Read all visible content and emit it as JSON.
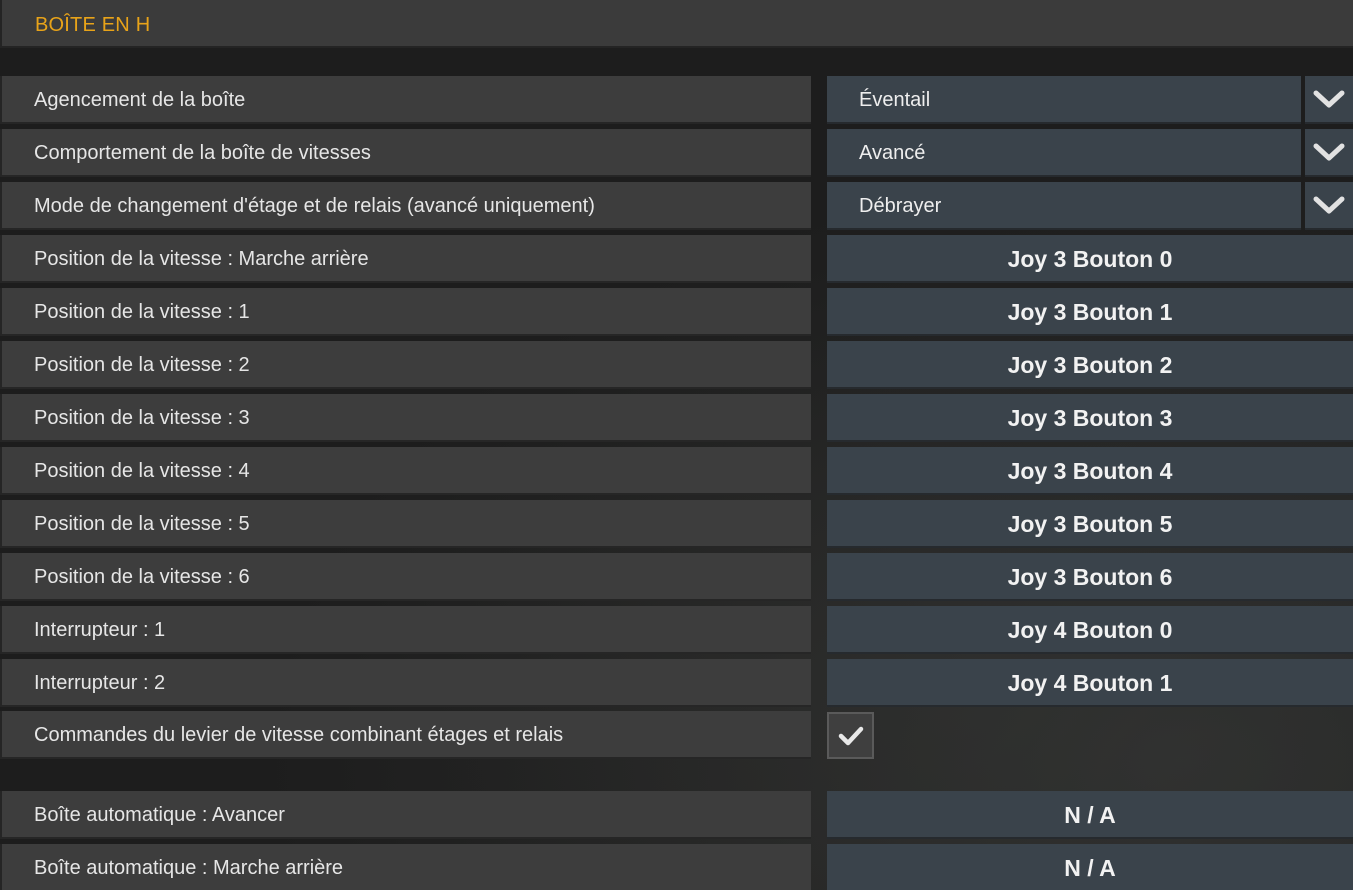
{
  "section": {
    "title": "BOÎTE EN H",
    "title_color": "#e8a319"
  },
  "settings": [
    {
      "label": "Agencement de la boîte",
      "type": "dropdown",
      "value": "Éventail",
      "icon": "chevron-down-icon"
    },
    {
      "label": "Comportement de la boîte de vitesses",
      "type": "dropdown",
      "value": "Avancé",
      "icon": "chevron-down-icon"
    },
    {
      "label": "Mode de changement d'étage et de relais (avancé uniquement)",
      "type": "dropdown",
      "value": "Débrayer",
      "icon": "chevron-down-icon"
    },
    {
      "label": "Position de la vitesse : Marche arrière",
      "type": "binding",
      "value": "Joy 3 Bouton 0"
    },
    {
      "label": "Position de la vitesse : 1",
      "type": "binding",
      "value": "Joy 3 Bouton 1"
    },
    {
      "label": "Position de la vitesse : 2",
      "type": "binding",
      "value": "Joy 3 Bouton 2"
    },
    {
      "label": "Position de la vitesse : 3",
      "type": "binding",
      "value": "Joy 3 Bouton 3"
    },
    {
      "label": "Position de la vitesse : 4",
      "type": "binding",
      "value": "Joy 3 Bouton 4"
    },
    {
      "label": "Position de la vitesse : 5",
      "type": "binding",
      "value": "Joy 3 Bouton 5"
    },
    {
      "label": "Position de la vitesse : 6",
      "type": "binding",
      "value": "Joy 3 Bouton 6"
    },
    {
      "label": "Interrupteur : 1",
      "type": "binding",
      "value": "Joy 4 Bouton 0"
    },
    {
      "label": "Interrupteur : 2",
      "type": "binding",
      "value": "Joy 4 Bouton 1"
    },
    {
      "label": "Commandes du levier de vitesse combinant étages et relais",
      "type": "checkbox",
      "checked": true,
      "icon": "checkmark-icon"
    },
    {
      "label": "Boîte automatique : Avancer",
      "type": "binding",
      "value": "N / A"
    },
    {
      "label": "Boîte automatique : Marche arrière",
      "type": "binding",
      "value": "N / A"
    }
  ]
}
